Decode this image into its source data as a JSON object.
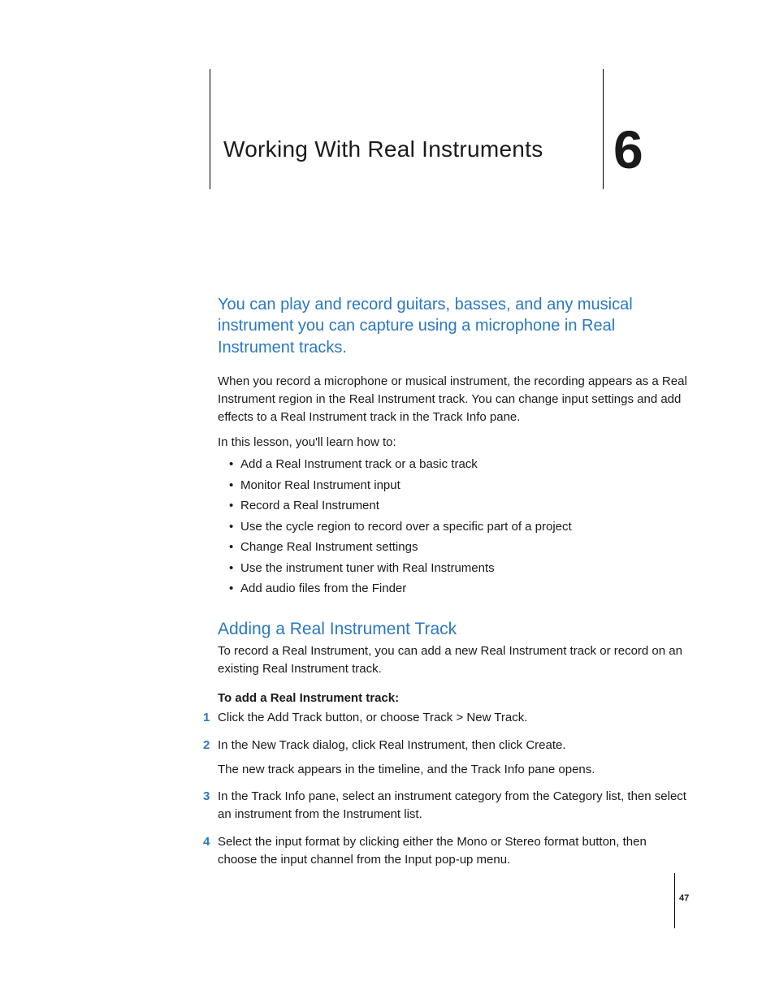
{
  "chapter": {
    "title": "Working With Real Instruments",
    "number": "6"
  },
  "intro_summary": "You can play and record guitars, basses, and any musical instrument you can capture using a microphone in Real Instrument tracks.",
  "intro_body": "When you record a microphone or musical instrument, the recording appears as a Real Instrument region in the Real Instrument track. You can change input settings and add effects to a Real Instrument track in the Track Info pane.",
  "lesson_lead": "In this lesson, you'll learn how to:",
  "bullets": [
    "Add a Real Instrument track or a basic track",
    "Monitor Real Instrument input",
    "Record a Real Instrument",
    "Use the cycle region to record over a specific part of a project",
    "Change Real Instrument settings",
    "Use the instrument tuner with Real Instruments",
    "Add audio files from the Finder"
  ],
  "section": {
    "heading": "Adding a Real Instrument Track",
    "lead": "To record a Real Instrument, you can add a new Real Instrument track or record on an existing Real Instrument track.",
    "subhead": "To add a Real Instrument track:",
    "steps": [
      {
        "text": "Click the Add Track button, or choose Track > New Track."
      },
      {
        "text": "In the New Track dialog, click Real Instrument, then click Create.",
        "followup": "The new track appears in the timeline, and the Track Info pane opens."
      },
      {
        "text": "In the Track Info pane, select an instrument category from the Category list, then select an instrument from the Instrument list."
      },
      {
        "text": "Select the input format by clicking either the Mono or Stereo format button, then choose the input channel from the Input pop-up menu."
      }
    ]
  },
  "page_number": "47"
}
